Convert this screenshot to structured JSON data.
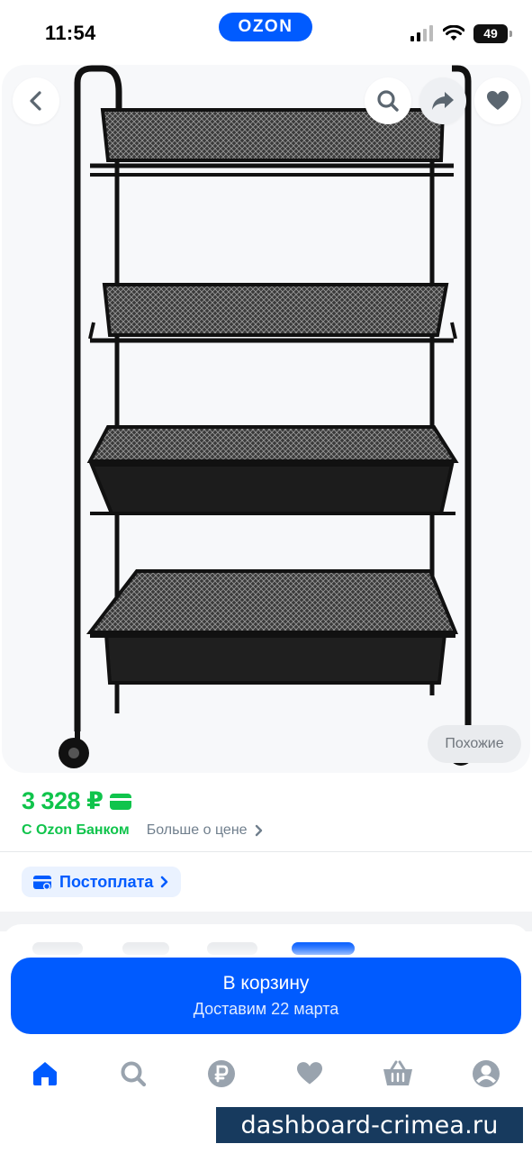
{
  "status_bar": {
    "time": "11:54",
    "battery": "49",
    "app_badge": "OZON"
  },
  "product": {
    "similar_label": "Похожие",
    "price": "3 328 ₽",
    "bank_label": "С Ozon Банком",
    "more_price_label": "Больше о цене",
    "postpay_label": "Постоплата"
  },
  "cart": {
    "button_label": "В корзину",
    "delivery_label": "Доставим 22 марта"
  },
  "bottom_nav": {
    "items": [
      "home-icon",
      "search-icon",
      "ruble-icon",
      "heart-icon",
      "basket-icon",
      "profile-icon"
    ],
    "active": "home-icon"
  },
  "watermark": "dashboard-crimea.ru",
  "colors": {
    "accent": "#005bff",
    "price": "#10c44c",
    "watermark_bg": "#173a5e"
  }
}
